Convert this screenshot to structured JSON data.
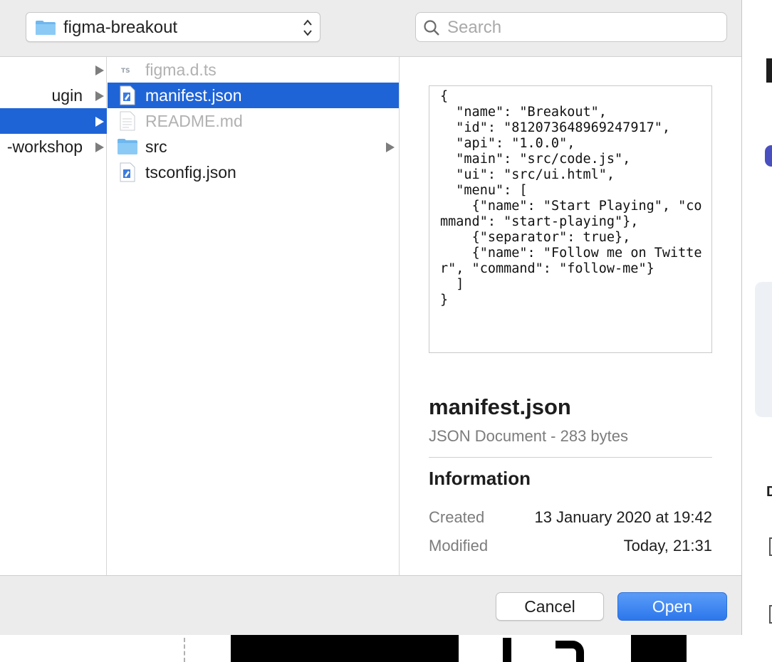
{
  "toolbar": {
    "path_popup_label": "figma-breakout",
    "search_placeholder": "Search"
  },
  "column1": {
    "items": [
      {
        "label": "",
        "selected": false
      },
      {
        "label": "ugin",
        "selected": false
      },
      {
        "label": "",
        "selected": true
      },
      {
        "label": "-workshop",
        "selected": false
      }
    ]
  },
  "column2": {
    "items": [
      {
        "label": "figma.d.ts",
        "icon": "typescript-file-icon",
        "dimmed": true,
        "selected": false,
        "has_children": false
      },
      {
        "label": "manifest.json",
        "icon": "json-file-icon",
        "dimmed": false,
        "selected": true,
        "has_children": false
      },
      {
        "label": "README.md",
        "icon": "text-file-icon",
        "dimmed": true,
        "selected": false,
        "has_children": false
      },
      {
        "label": "src",
        "icon": "folder-icon",
        "dimmed": false,
        "selected": false,
        "has_children": true
      },
      {
        "label": "tsconfig.json",
        "icon": "json-file-icon",
        "dimmed": false,
        "selected": false,
        "has_children": false
      }
    ]
  },
  "preview": {
    "code": "{\n  \"name\": \"Breakout\",\n  \"id\": \"812073648969247917\",\n  \"api\": \"1.0.0\",\n  \"main\": \"src/code.js\",\n  \"ui\": \"src/ui.html\",\n  \"menu\": [\n    {\"name\": \"Start Playing\", \"command\": \"start-playing\"},\n    {\"separator\": true},\n    {\"name\": \"Follow me on Twitter\", \"command\": \"follow-me\"}\n  ]\n}",
    "file_name": "manifest.json",
    "file_kind": "JSON Document - 283 bytes",
    "info_heading": "Information",
    "created_label": "Created",
    "created_value": "13 January 2020 at 19:42",
    "modified_label": "Modified",
    "modified_value": "Today, 21:31"
  },
  "footer": {
    "cancel_label": "Cancel",
    "open_label": "Open"
  },
  "colors": {
    "selection": "#1f64d7",
    "primary_button": "#2c77ec",
    "folder": "#6fb7ef"
  }
}
